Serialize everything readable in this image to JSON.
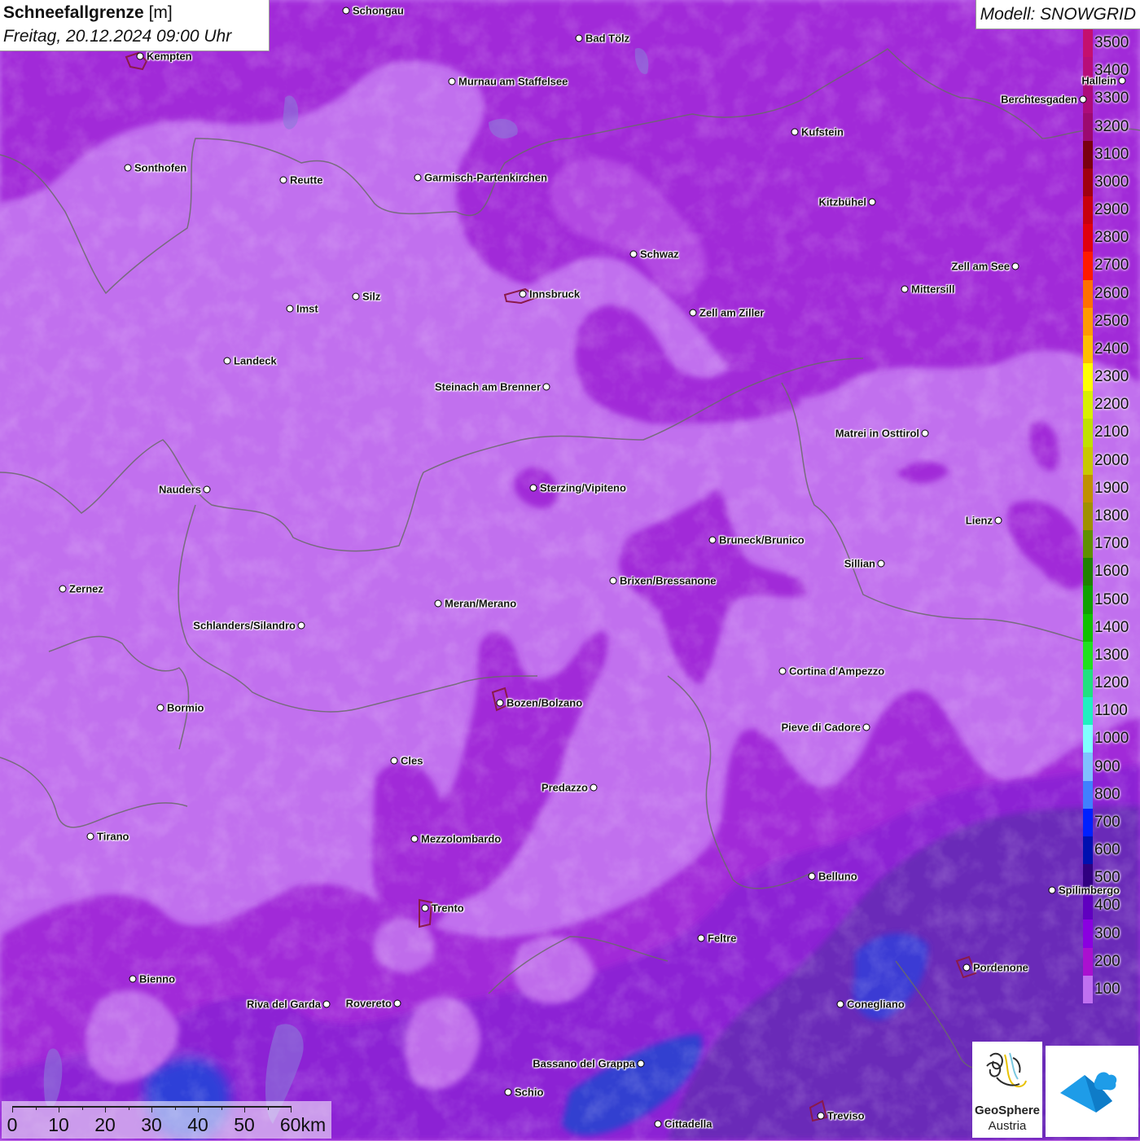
{
  "title": {
    "variable": "Schneefallgrenze",
    "unit": "[m]",
    "datetime": "Freitag, 20.12.2024 09:00 Uhr"
  },
  "model_label": "Modell: SNOWGRID",
  "legend": {
    "levels": [
      {
        "value": "3500",
        "color": "#c4106e"
      },
      {
        "value": "3400",
        "color": "#b80e78"
      },
      {
        "value": "3300",
        "color": "#ad0c7a"
      },
      {
        "value": "3200",
        "color": "#9c0a70"
      },
      {
        "value": "3100",
        "color": "#7a0010"
      },
      {
        "value": "3000",
        "color": "#a00010"
      },
      {
        "value": "2900",
        "color": "#c8000e"
      },
      {
        "value": "2800",
        "color": "#e0000e"
      },
      {
        "value": "2700",
        "color": "#ff1a00"
      },
      {
        "value": "2600",
        "color": "#ff7000"
      },
      {
        "value": "2500",
        "color": "#ff9a00"
      },
      {
        "value": "2400",
        "color": "#ffbe00"
      },
      {
        "value": "2300",
        "color": "#ffff00"
      },
      {
        "value": "2200",
        "color": "#d8f000"
      },
      {
        "value": "2100",
        "color": "#c0e000"
      },
      {
        "value": "2000",
        "color": "#c8c800"
      },
      {
        "value": "1900",
        "color": "#c09000"
      },
      {
        "value": "1800",
        "color": "#a09000"
      },
      {
        "value": "1700",
        "color": "#609000"
      },
      {
        "value": "1600",
        "color": "#208000"
      },
      {
        "value": "1500",
        "color": "#10a000"
      },
      {
        "value": "1400",
        "color": "#10c000"
      },
      {
        "value": "1300",
        "color": "#20e020"
      },
      {
        "value": "1200",
        "color": "#20e080"
      },
      {
        "value": "1100",
        "color": "#20f0c0"
      },
      {
        "value": "1000",
        "color": "#80ffff"
      },
      {
        "value": "900",
        "color": "#80c0ff"
      },
      {
        "value": "800",
        "color": "#4080ff"
      },
      {
        "value": "700",
        "color": "#0020ff"
      },
      {
        "value": "600",
        "color": "#0010b0"
      },
      {
        "value": "500",
        "color": "#300080"
      },
      {
        "value": "400",
        "color": "#6000c0"
      },
      {
        "value": "300",
        "color": "#8a00e0"
      },
      {
        "value": "200",
        "color": "#aa10d0"
      },
      {
        "value": "100",
        "color": "#c070f0"
      }
    ]
  },
  "cities": [
    {
      "name": "Schongau",
      "side": "right"
    },
    {
      "name": "Bad Tölz",
      "side": "right"
    },
    {
      "name": "Kempten",
      "side": "right"
    },
    {
      "name": "Murnau am Staffelsee",
      "side": "right"
    },
    {
      "name": "Hallein",
      "side": "left"
    },
    {
      "name": "Berchtesgaden",
      "side": "left"
    },
    {
      "name": "Kufstein",
      "side": "right"
    },
    {
      "name": "Sonthofen",
      "side": "right"
    },
    {
      "name": "Reutte",
      "side": "right"
    },
    {
      "name": "Garmisch-Partenkirchen",
      "side": "right"
    },
    {
      "name": "Kitzbühel",
      "side": "left"
    },
    {
      "name": "Schwaz",
      "side": "right"
    },
    {
      "name": "Zell am See",
      "side": "left"
    },
    {
      "name": "Mittersill",
      "side": "right"
    },
    {
      "name": "Innsbruck",
      "side": "right"
    },
    {
      "name": "Imst",
      "side": "right"
    },
    {
      "name": "Silz",
      "side": "right"
    },
    {
      "name": "Zell am Ziller",
      "side": "right"
    },
    {
      "name": "Landeck",
      "side": "right"
    },
    {
      "name": "Steinach am Brenner",
      "side": "left"
    },
    {
      "name": "Matrei in Osttirol",
      "side": "left"
    },
    {
      "name": "Nauders",
      "side": "left"
    },
    {
      "name": "Sterzing/Vipiteno",
      "side": "right"
    },
    {
      "name": "Lienz",
      "side": "left"
    },
    {
      "name": "Bruneck/Brunico",
      "side": "right"
    },
    {
      "name": "Sillian",
      "side": "left"
    },
    {
      "name": "Brixen/Bressanone",
      "side": "right"
    },
    {
      "name": "Zernez",
      "side": "right"
    },
    {
      "name": "Meran/Merano",
      "side": "right"
    },
    {
      "name": "Schlanders/Silandro",
      "side": "left"
    },
    {
      "name": "Cortina d'Ampezzo",
      "side": "right"
    },
    {
      "name": "Bozen/Bolzano",
      "side": "right"
    },
    {
      "name": "Bormio",
      "side": "right"
    },
    {
      "name": "Pieve di Cadore",
      "side": "left"
    },
    {
      "name": "Cles",
      "side": "right"
    },
    {
      "name": "Predazzo",
      "side": "left"
    },
    {
      "name": "Tirano",
      "side": "right"
    },
    {
      "name": "Mezzolombardo",
      "side": "right"
    },
    {
      "name": "Belluno",
      "side": "right"
    },
    {
      "name": "Spilimbergo",
      "side": "right"
    },
    {
      "name": "Trento",
      "side": "right"
    },
    {
      "name": "Feltre",
      "side": "right"
    },
    {
      "name": "Pordenone",
      "side": "right"
    },
    {
      "name": "Bienno",
      "side": "right"
    },
    {
      "name": "Riva del Garda",
      "side": "left"
    },
    {
      "name": "Rovereto",
      "side": "left"
    },
    {
      "name": "Conegliano",
      "side": "right"
    },
    {
      "name": "Bassano del Grappa",
      "side": "left"
    },
    {
      "name": "Schio",
      "side": "right"
    },
    {
      "name": "Treviso",
      "side": "right"
    },
    {
      "name": "Cittadella",
      "side": "right"
    }
  ],
  "scale_bar": {
    "labels": [
      "0",
      "10",
      "20",
      "30",
      "40",
      "50",
      "60km"
    ]
  },
  "logos": {
    "geosphere_line1": "GeoSphere",
    "geosphere_line2": "Austria",
    "app_logo_icon": "snowgrid-mountain-cloud-icon"
  }
}
